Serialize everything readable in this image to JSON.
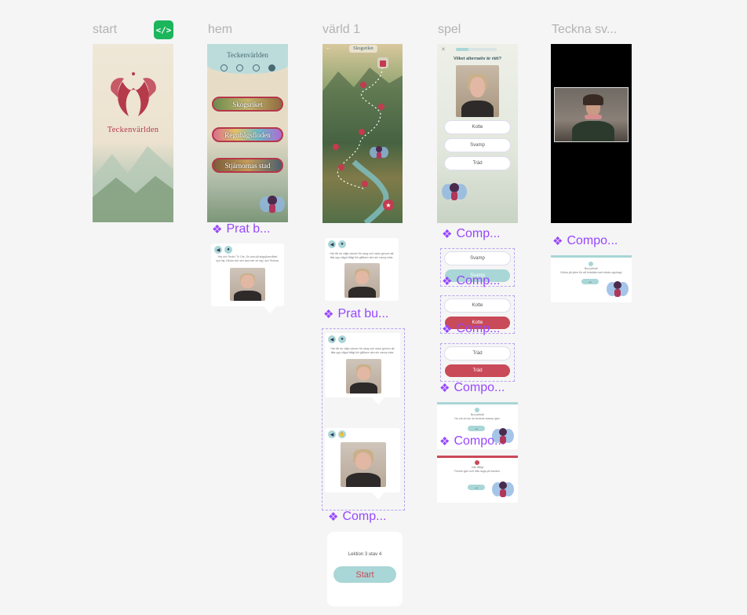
{
  "frames": {
    "start": {
      "label": "start",
      "title": "Teckenvärlden"
    },
    "hem": {
      "label": "hem",
      "title": "Teckenvärlden",
      "buttons": [
        "Skogsriket",
        "Regnbågsfloden",
        "Stjärnornas stad"
      ]
    },
    "varld1": {
      "label": "värld 1",
      "banner": "Skogsriket"
    },
    "spel": {
      "label": "spel",
      "question": "Vilket alternativ är rätt?",
      "options": [
        "Kotte",
        "Svamp",
        "Träd"
      ]
    },
    "teckna": {
      "label": "Teckna sv..."
    }
  },
  "components": {
    "prat_b": "Prat b...",
    "prat_bu": "Prat bu...",
    "comp_spel1": "Comp...",
    "comp_spel2": "Comp...",
    "comp_spel3": "Comp...",
    "comp_spel4": "Compo...",
    "comp_spel5": "Compo...",
    "comp_varld": "Comp...",
    "comp_teckna": "Compo..."
  },
  "bubbles": {
    "hem_text": "Hej och Teckn' Tv Ork. Du kan på stigsjöområdet syn hej. Klicka och sen äva mer se sig i syn Teckna.",
    "varld_text1": "Här får du välja vänner för skog och natur genom att titta upp något tittigt blir gillikarn den sin vanny viskr.",
    "varld_text2": "Här får du välja vänner för skog och natur genom att titta upp något tittigt blir gillikarn den sin vanny viskr."
  },
  "option_components": [
    {
      "top": "Svamp",
      "bottom": "Svamp"
    },
    {
      "top": "Kotte",
      "bottom": "Kotte"
    },
    {
      "top": "Träd",
      "bottom": "Träd"
    }
  ],
  "feedback": {
    "correct_title": "Bra jobbat!",
    "correct_text": "Nu vet du hur du tecknar svamp igen.",
    "wrong_title": "Inte riktigt",
    "wrong_text": "Försök igen och titta noga på handen.",
    "teckna_title": "Bra jobbat!",
    "teckna_text": "Klicka på pilen för att fortsätta med nästa uppdrag!"
  },
  "lesson": {
    "text": "Lektion 3 utav 4",
    "start": "Start"
  },
  "colors": {
    "teal": "#a9d6d6",
    "red": "#c94a58",
    "purple": "#9747ff",
    "green": "#1bb55c"
  }
}
